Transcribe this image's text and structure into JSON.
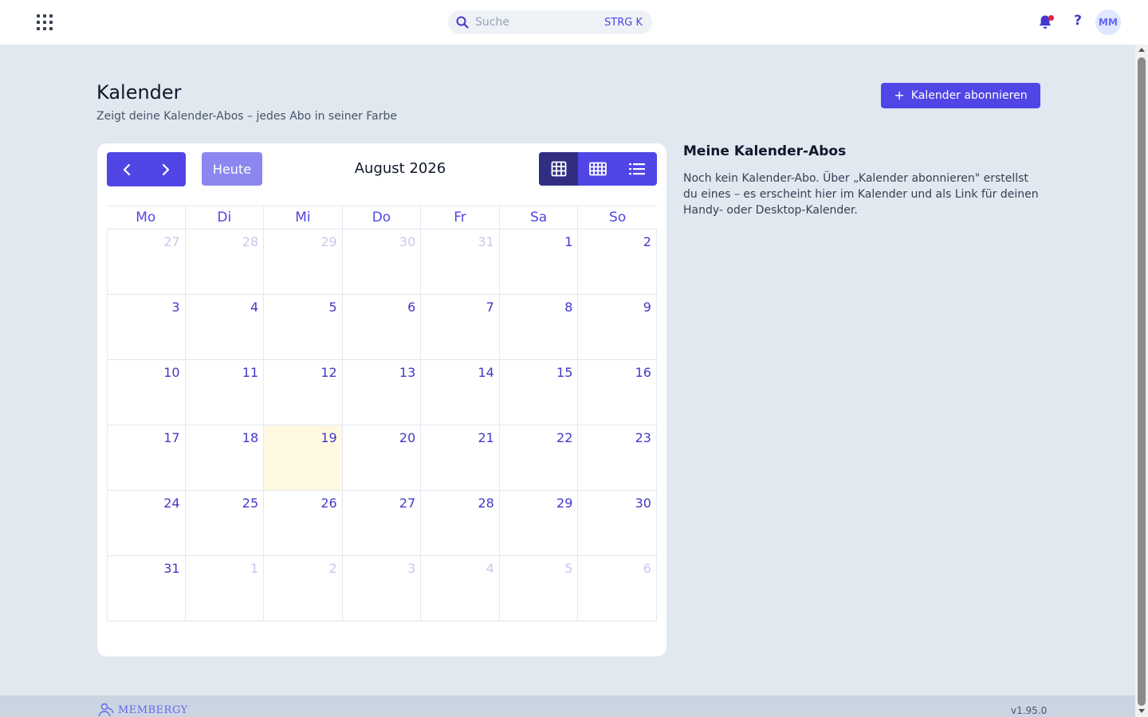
{
  "header": {
    "search_placeholder": "Suche",
    "search_shortcut": "STRG K",
    "avatar_initials": "MM",
    "help_label": "?"
  },
  "page": {
    "title": "Kalender",
    "subtitle": "Zeigt deine Kalender-Abos – jedes Abo in seiner Farbe",
    "subscribe_label": "Kalender abonnieren",
    "subscribe_icon": "+"
  },
  "calendar": {
    "today_label": "Heute",
    "month_title": "August 2026",
    "weekdays": [
      "Mo",
      "Di",
      "Mi",
      "Do",
      "Fr",
      "Sa",
      "So"
    ],
    "weeks": [
      [
        {
          "n": "27",
          "other": true
        },
        {
          "n": "28",
          "other": true
        },
        {
          "n": "29",
          "other": true
        },
        {
          "n": "30",
          "other": true
        },
        {
          "n": "31",
          "other": true
        },
        {
          "n": "1"
        },
        {
          "n": "2"
        }
      ],
      [
        {
          "n": "3"
        },
        {
          "n": "4"
        },
        {
          "n": "5"
        },
        {
          "n": "6"
        },
        {
          "n": "7"
        },
        {
          "n": "8"
        },
        {
          "n": "9"
        }
      ],
      [
        {
          "n": "10"
        },
        {
          "n": "11"
        },
        {
          "n": "12"
        },
        {
          "n": "13"
        },
        {
          "n": "14"
        },
        {
          "n": "15"
        },
        {
          "n": "16"
        }
      ],
      [
        {
          "n": "17"
        },
        {
          "n": "18"
        },
        {
          "n": "19",
          "today": true
        },
        {
          "n": "20"
        },
        {
          "n": "21"
        },
        {
          "n": "22"
        },
        {
          "n": "23"
        }
      ],
      [
        {
          "n": "24"
        },
        {
          "n": "25"
        },
        {
          "n": "26"
        },
        {
          "n": "27"
        },
        {
          "n": "28"
        },
        {
          "n": "29"
        },
        {
          "n": "30"
        }
      ],
      [
        {
          "n": "31"
        },
        {
          "n": "1",
          "other": true
        },
        {
          "n": "2",
          "other": true
        },
        {
          "n": "3",
          "other": true
        },
        {
          "n": "4",
          "other": true
        },
        {
          "n": "5",
          "other": true
        },
        {
          "n": "6",
          "other": true
        }
      ]
    ]
  },
  "sidebar": {
    "title": "Meine Kalender-Abos",
    "text": "Noch kein Kalender-Abo. Über „Kalender abonnieren\" erstellst du eines – es erscheint hier im Kalender und als Link für deinen Handy- oder Desktop-Kalender."
  },
  "footer": {
    "logo_text": "MEMBERGY",
    "version": "v1.95.0"
  },
  "colors": {
    "accent": "#4f46e5",
    "accent_dark": "#312e81",
    "today_bg": "#fef9e0",
    "notification_dot": "#e11d48"
  }
}
